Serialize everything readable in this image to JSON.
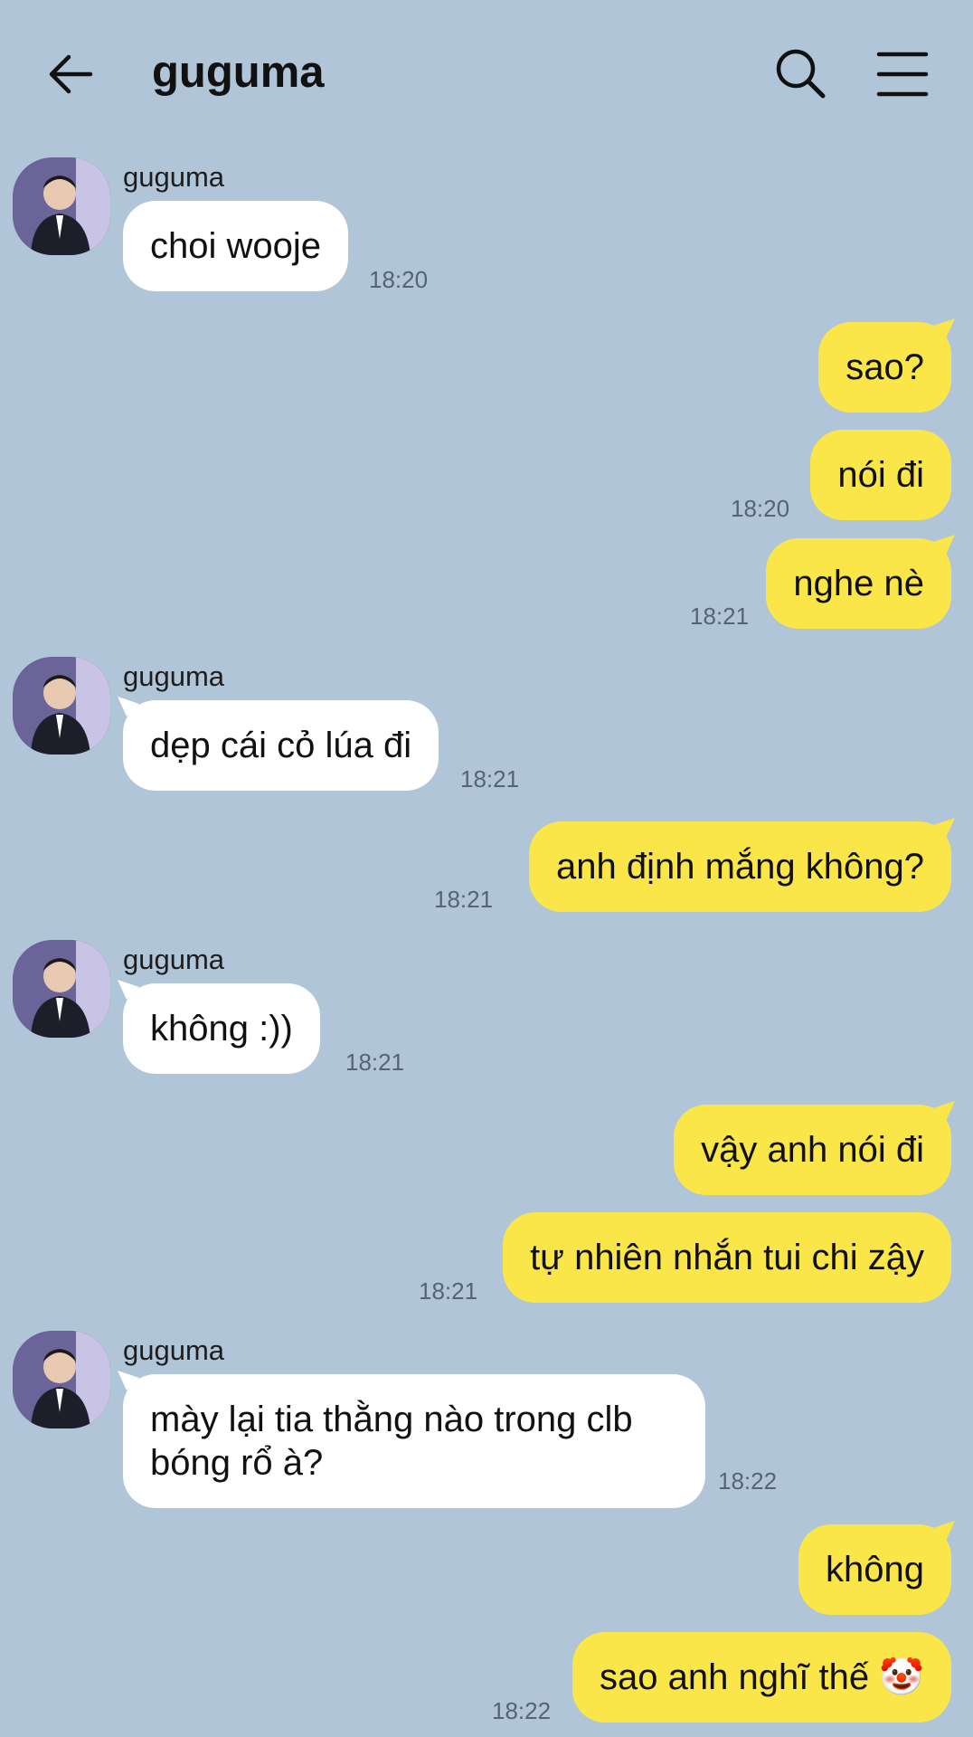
{
  "header": {
    "title": "guguma",
    "back_icon": "arrow-left-icon",
    "search_icon": "search-icon",
    "menu_icon": "hamburger-menu-icon"
  },
  "colors": {
    "background": "#b1c5d9",
    "incoming_bubble": "#ffffff",
    "outgoing_bubble": "#fbe64a"
  },
  "messages": [
    {
      "sender": "guguma",
      "text": "choi wooje",
      "time": "18:20"
    },
    {
      "text": "sao?"
    },
    {
      "text": "nói đi",
      "time": "18:20"
    },
    {
      "text": "nghe nè",
      "time": "18:21"
    },
    {
      "sender": "guguma",
      "text": "dẹp cái cỏ lúa đi",
      "time": "18:21"
    },
    {
      "text": "anh định mắng không?",
      "time": "18:21"
    },
    {
      "sender": "guguma",
      "text": "không :))",
      "time": "18:21"
    },
    {
      "text": "vậy anh nói đi"
    },
    {
      "text": "tự nhiên nhắn tui chi zậy",
      "time": "18:21"
    },
    {
      "sender": "guguma",
      "text": "mày lại tia thằng nào trong clb bóng rổ à?",
      "time": "18:22"
    },
    {
      "text": "không"
    },
    {
      "text": "sao anh nghĩ thế 🤡",
      "time": "18:22"
    }
  ]
}
